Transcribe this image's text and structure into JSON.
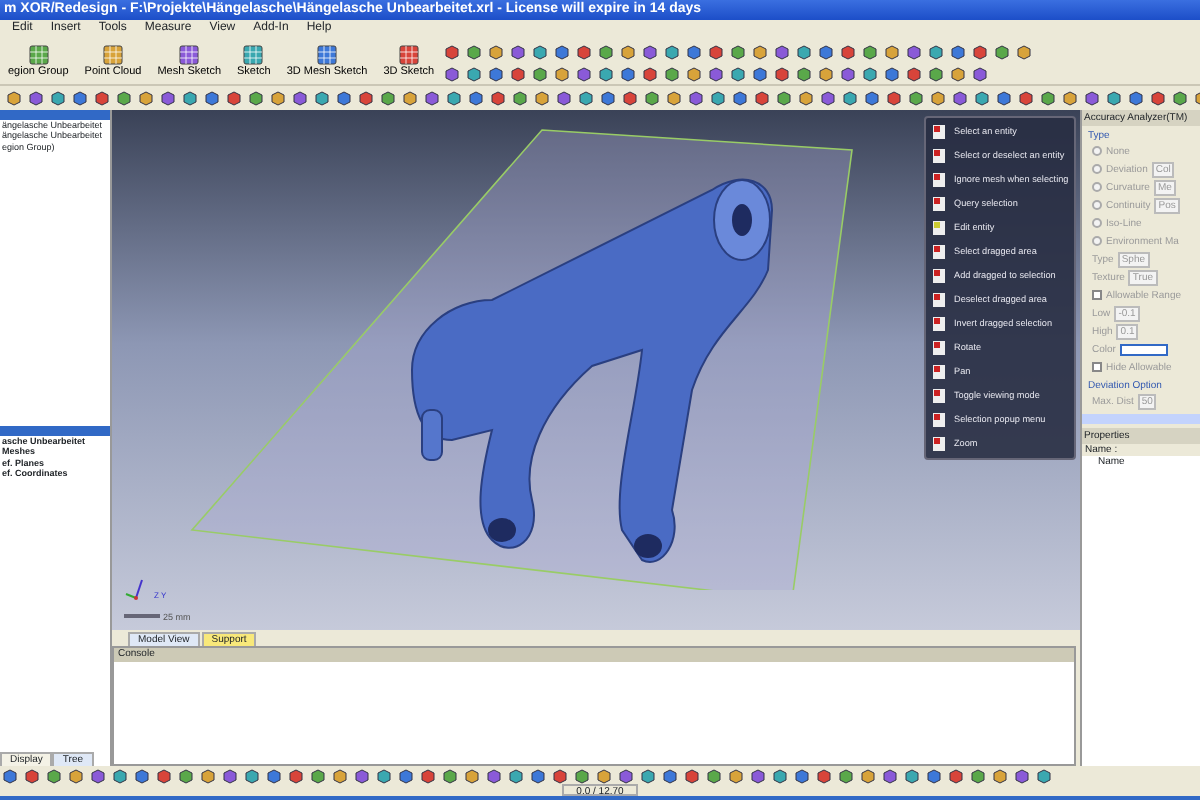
{
  "window": {
    "title": "m XOR/Redesign - F:\\Projekte\\Hängelasche\\Hängelasche Unbearbeitet.xrl - License will expire in 14 days"
  },
  "menu": [
    "Edit",
    "Insert",
    "Tools",
    "Measure",
    "View",
    "Add-In",
    "Help"
  ],
  "feature_toolbar": [
    "egion Group",
    "Point Cloud",
    "Mesh Sketch",
    "Sketch",
    "3D Mesh Sketch",
    "3D Sketch"
  ],
  "tree_panel": {
    "items": [
      "ängelasche Unbearbeitet",
      "ängelasche Unbearbeitet",
      "egion Group)"
    ]
  },
  "tree_panel_2": {
    "items": [
      "asche Unbearbeitet",
      "Meshes",
      "ef. Planes",
      "ef. Coordinates"
    ]
  },
  "left_tabs": [
    {
      "label": "Display",
      "selected": false
    },
    {
      "label": "Tree",
      "selected": true
    }
  ],
  "viewport": {
    "axes": [
      "Z",
      "Y"
    ],
    "scale_label": "25 mm",
    "context_menu": [
      "Select an entity",
      "Select or deselect an entity",
      "Ignore mesh when selecting",
      "Query selection",
      "Edit entity",
      "Select dragged area",
      "Add dragged to selection",
      "Deselect dragged area",
      "Invert dragged selection",
      "Rotate",
      "Pan",
      "Toggle viewing mode",
      "Selection popup menu",
      "Zoom"
    ]
  },
  "view_tabs": [
    {
      "label": "Model View",
      "selected": true
    },
    {
      "label": "Support",
      "selected": false
    }
  ],
  "console": {
    "title": "Console"
  },
  "accuracy_panel": {
    "title": "Accuracy Analyzer(TM)",
    "type_group": "Type",
    "options": [
      {
        "label": "None",
        "selected": false
      },
      {
        "label": "Deviation",
        "value": "Col",
        "selected": false
      },
      {
        "label": "Curvature",
        "value": "Me",
        "selected": false
      },
      {
        "label": "Continuity",
        "value": "Pos",
        "selected": false
      },
      {
        "label": "Iso-Line",
        "selected": false
      },
      {
        "label": "Environment Ma",
        "selected": false
      }
    ],
    "fields": [
      {
        "label": "Type",
        "value": "Sphe"
      },
      {
        "label": "Texture",
        "value": "True"
      }
    ],
    "allowable": {
      "label": "Allowable Range",
      "checked": false,
      "low_label": "Low",
      "low": "-0.1",
      "high_label": "High",
      "high": "0.1",
      "color_label": "Color",
      "hide_label": "Hide Allowable",
      "hide_checked": false
    },
    "deviation_group": "Deviation Option",
    "max_label": "Max. Dist",
    "max_value": "50",
    "properties_title": "Properties",
    "sort_label": "Name :",
    "column": "Name"
  },
  "status_bar": {
    "text": "0.0 / 12.70"
  }
}
